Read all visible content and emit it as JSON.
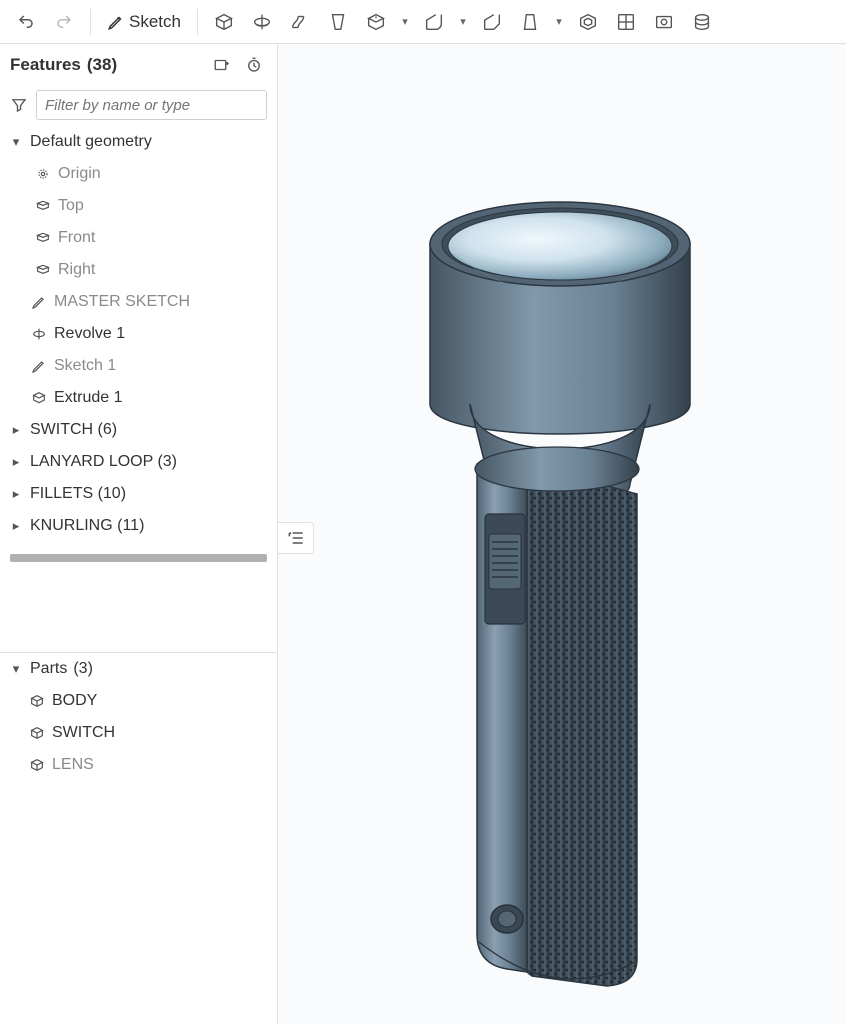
{
  "toolbar": {
    "undo": "Undo",
    "redo": "Redo",
    "sketch_label": "Sketch"
  },
  "features_panel": {
    "title_prefix": "Features",
    "count": "(38)",
    "filter_placeholder": "Filter by name or type"
  },
  "tree": [
    {
      "depth": 0,
      "caret": "down",
      "icon": "",
      "label": "Default geometry",
      "muted": false
    },
    {
      "depth": 1,
      "caret": "",
      "icon": "origin",
      "label": "Origin",
      "muted": true
    },
    {
      "depth": 1,
      "caret": "",
      "icon": "plane",
      "label": "Top",
      "muted": true
    },
    {
      "depth": 1,
      "caret": "",
      "icon": "plane",
      "label": "Front",
      "muted": true
    },
    {
      "depth": 1,
      "caret": "",
      "icon": "plane",
      "label": "Right",
      "muted": true
    },
    {
      "depth": 0,
      "caret": "",
      "icon": "sketch",
      "label": "MASTER SKETCH",
      "muted": true
    },
    {
      "depth": 0,
      "caret": "",
      "icon": "revolve",
      "label": "Revolve 1",
      "muted": false
    },
    {
      "depth": 0,
      "caret": "",
      "icon": "sketch",
      "label": "Sketch 1",
      "muted": true
    },
    {
      "depth": 0,
      "caret": "",
      "icon": "extrude",
      "label": "Extrude 1",
      "muted": false
    },
    {
      "depth": 0,
      "caret": "right",
      "icon": "",
      "label": "SWITCH (6)",
      "muted": false
    },
    {
      "depth": 0,
      "caret": "right",
      "icon": "",
      "label": "LANYARD LOOP (3)",
      "muted": false
    },
    {
      "depth": 0,
      "caret": "right",
      "icon": "",
      "label": "FILLETS (10)",
      "muted": false
    },
    {
      "depth": 0,
      "caret": "right",
      "icon": "",
      "label": "KNURLING (11)",
      "muted": false
    }
  ],
  "parts_panel": {
    "title_prefix": "Parts",
    "count": "(3)"
  },
  "parts": [
    {
      "icon": "part",
      "label": "BODY",
      "muted": false
    },
    {
      "icon": "part",
      "label": "SWITCH",
      "muted": false
    },
    {
      "icon": "part",
      "label": "LENS",
      "muted": true
    }
  ],
  "model": "flashlight",
  "colors": {
    "body": "#6b8194",
    "body_light": "#8aa0b3",
    "body_dark": "#3d4c58",
    "reflector_light": "#dceaf2",
    "reflector_mid": "#a8c2d4"
  }
}
